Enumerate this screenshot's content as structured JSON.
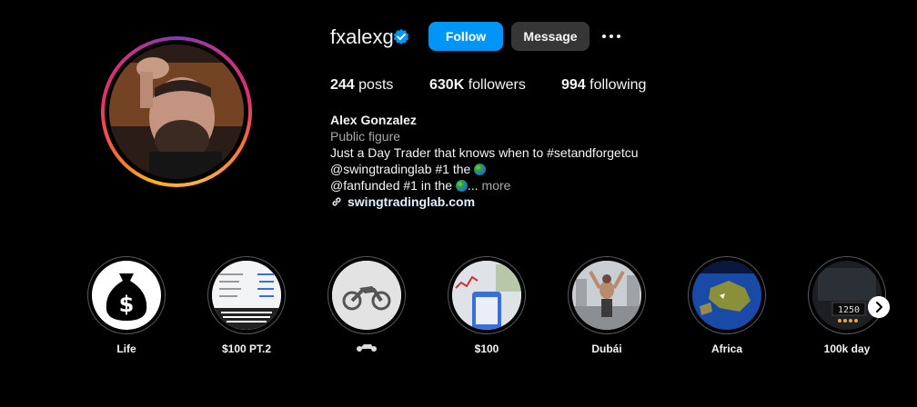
{
  "profile": {
    "username": "fxalexg",
    "verified": true,
    "follow_label": "Follow",
    "message_label": "Message",
    "stats": {
      "posts_count": "244",
      "posts_label": "posts",
      "followers_count": "630K",
      "followers_label": "followers",
      "following_count": "994",
      "following_label": "following"
    },
    "bio": {
      "name": "Alex Gonzalez",
      "category": "Public figure",
      "line1": "Just a Day Trader that knows when to #setandforgetcu",
      "line2": "@swingtradinglab #1 the",
      "line3": "@fanfunded #1 in the",
      "ellipsis": "...",
      "more_label": "more",
      "link": "swingtradinglab.com"
    }
  },
  "highlights": [
    {
      "label": "Life",
      "icon": "money-bag-icon"
    },
    {
      "label": "$100 PT.2",
      "icon": "trading-screenshot"
    },
    {
      "label": "",
      "icon": "motorcycle-icon"
    },
    {
      "label": "$100",
      "icon": "phone-chart"
    },
    {
      "label": "Dubái",
      "icon": "person-photo"
    },
    {
      "label": "Africa",
      "icon": "earth-map"
    },
    {
      "label": "100k day",
      "icon": "clock-display"
    }
  ],
  "colors": {
    "accent": "#0095f6",
    "verified": "#0095f6",
    "secondary_button": "#363636",
    "background": "#000000"
  }
}
